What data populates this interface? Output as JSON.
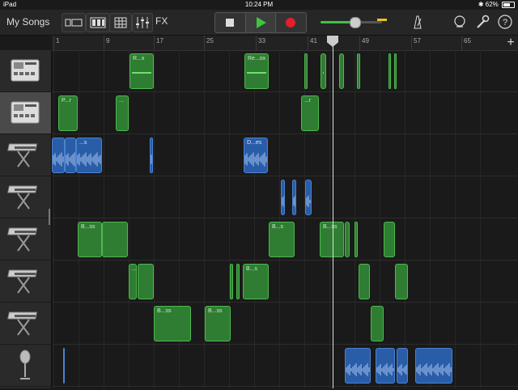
{
  "status_bar": {
    "carrier": "iPad",
    "time": "10:24 PM",
    "battery": "62%",
    "battery_fraction": 0.62
  },
  "toolbar": {
    "my_songs": "My Songs",
    "fx_label": "FX",
    "master_volume": 0.55
  },
  "ruler": {
    "bars": [
      "1",
      "9",
      "17",
      "25",
      "33",
      "41",
      "49",
      "57",
      "65"
    ]
  },
  "tracks": [
    {
      "name": "drum-machine-1",
      "selected": false
    },
    {
      "name": "drum-machine-2",
      "selected": true
    },
    {
      "name": "keyboard-1",
      "selected": false
    },
    {
      "name": "keyboard-2",
      "selected": false
    },
    {
      "name": "keyboard-3",
      "selected": false
    },
    {
      "name": "keyboard-4",
      "selected": false
    },
    {
      "name": "keyboard-5",
      "selected": false
    },
    {
      "name": "microphone",
      "selected": false
    }
  ],
  "regions": {
    "t0": [
      {
        "label": "R...x"
      },
      {
        "label": "Re...ox"
      }
    ],
    "t1": [
      {
        "label": "P...r"
      },
      {
        "label": "..."
      },
      {
        "label": "...r"
      }
    ],
    "t2": [
      {
        "label": "...s"
      },
      {
        "label": "D...es"
      }
    ],
    "t4": [
      {
        "label": "B...ss"
      },
      {
        "label": "B...s"
      },
      {
        "label": "B...ss"
      }
    ],
    "t5": [
      {
        "label": "..."
      },
      {
        "label": "B...s"
      }
    ],
    "t6": [
      {
        "label": "B...ss"
      },
      {
        "label": "B...ss"
      }
    ]
  },
  "colors": {
    "midi_region": "#2f7d32",
    "audio_region": "#2a5da8",
    "play": "#3ec43e",
    "record": "#e0202a"
  }
}
